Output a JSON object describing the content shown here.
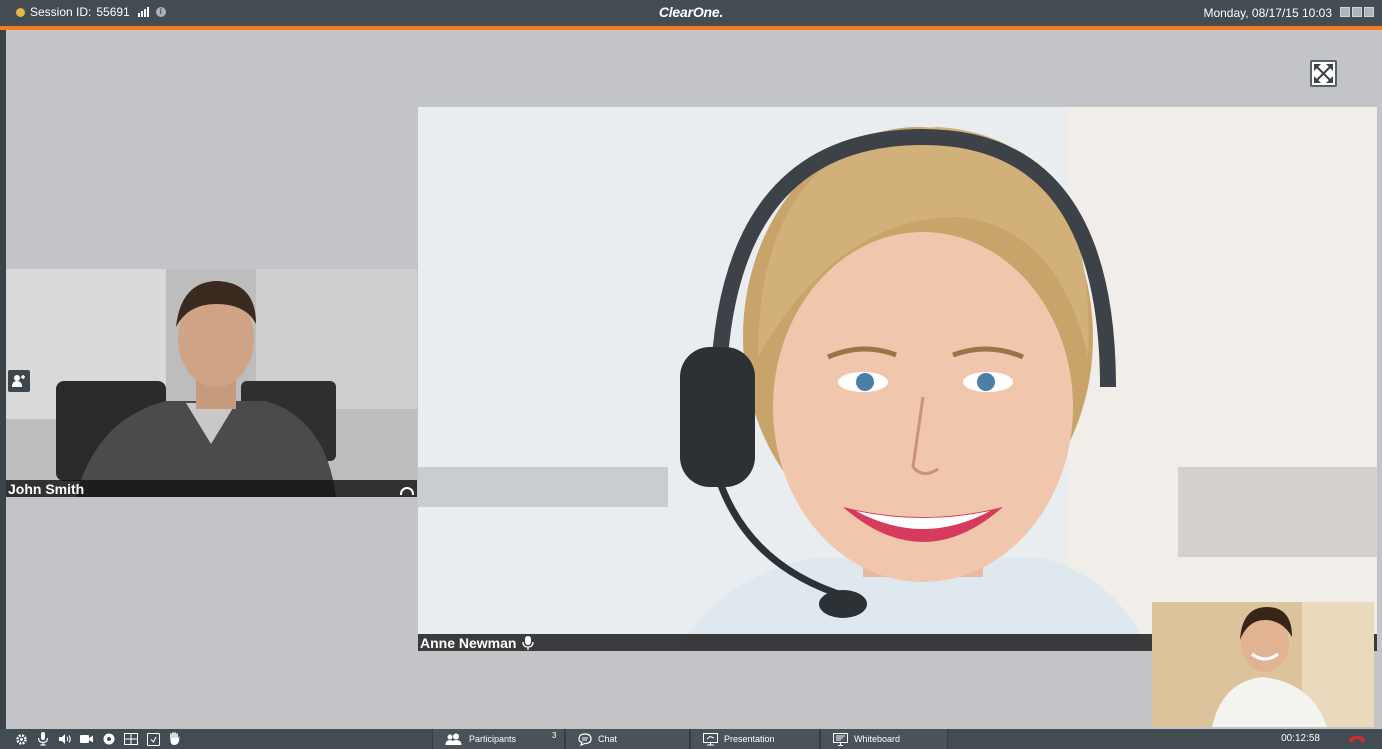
{
  "topbar": {
    "session_label": "Session ID:",
    "session_id": "55691",
    "brand": "ClearOne.",
    "datetime": "Monday, 08/17/15  10:03"
  },
  "participants": {
    "john": {
      "name": "John Smith"
    },
    "anne": {
      "name": "Anne Newman"
    }
  },
  "bottombar": {
    "tabs": [
      {
        "label": "Participants",
        "icon": "participants-icon"
      },
      {
        "label": "Chat",
        "icon": "chat-icon"
      },
      {
        "label": "Presentation",
        "icon": "presentation-icon"
      },
      {
        "label": "Whiteboard",
        "icon": "whiteboard-icon"
      }
    ],
    "participants_count": "3",
    "timer": "00:12:58",
    "tools": [
      "settings-icon",
      "microphone-icon",
      "speaker-icon",
      "camera-icon",
      "record-icon",
      "layout-icon",
      "share-screen-icon",
      "raise-hand-icon"
    ]
  },
  "colors": {
    "bar": "#434c53",
    "accent": "#f47b20",
    "background": "#c3c4c8",
    "end_call": "#d62b2b"
  }
}
